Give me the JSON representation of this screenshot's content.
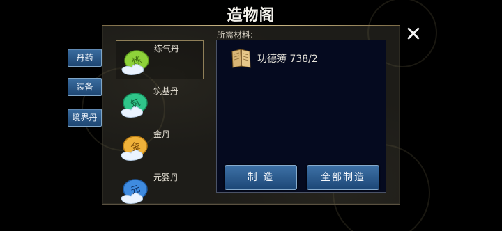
{
  "window": {
    "title": "造物阁",
    "close_glyph": "✕"
  },
  "tabs": [
    {
      "label": "丹药"
    },
    {
      "label": "装备"
    },
    {
      "label": "境界丹"
    }
  ],
  "items": [
    {
      "label": "练气丹",
      "icon": "green-pill-icon",
      "color": "#8ed23a",
      "glyph": "炼",
      "selected": true
    },
    {
      "label": "筑基丹",
      "icon": "teal-pill-icon",
      "color": "#2fc58a",
      "glyph": "筑",
      "selected": false
    },
    {
      "label": "金丹",
      "icon": "gold-pill-icon",
      "color": "#f0b23a",
      "glyph": "金",
      "selected": false
    },
    {
      "label": "元婴丹",
      "icon": "blue-pill-icon",
      "color": "#3f8be0",
      "glyph": "元",
      "selected": false
    }
  ],
  "requirements": {
    "label": "所需材料:",
    "materials": [
      {
        "name": "功德簿",
        "count": "738/2",
        "icon": "book-icon"
      }
    ]
  },
  "actions": {
    "make_label": "制 造",
    "make_all_label": "全部制造"
  },
  "colors": {
    "tab_blue": "#2a5a8e",
    "panel_border": "#5a5140",
    "req_bg": "#050a1f"
  }
}
